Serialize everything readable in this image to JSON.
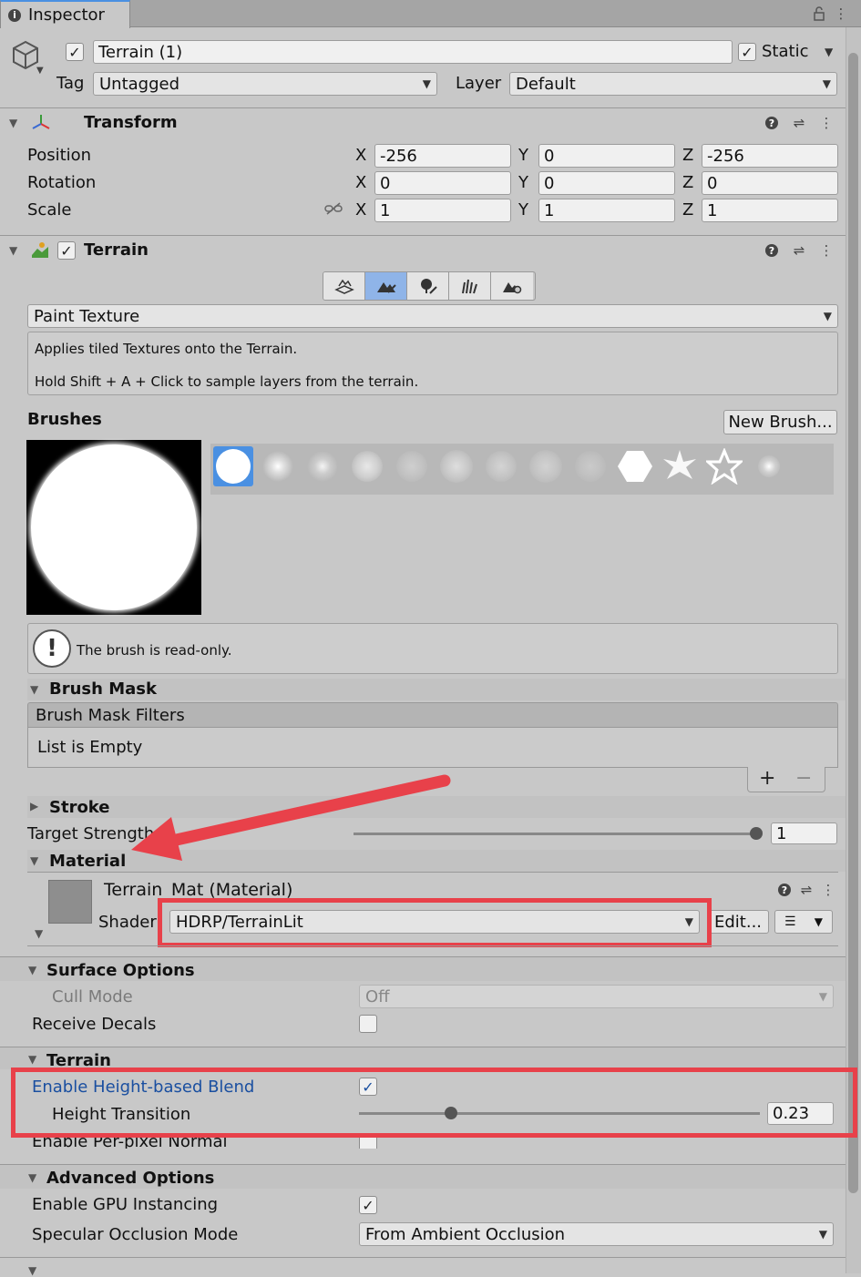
{
  "window": {
    "tab_title": "Inspector"
  },
  "header": {
    "object_name": "Terrain (1)",
    "static_label": "Static",
    "tag_label": "Tag",
    "tag_value": "Untagged",
    "layer_label": "Layer",
    "layer_value": "Default"
  },
  "transform": {
    "title": "Transform",
    "rows": [
      {
        "label": "Position",
        "x": "-256",
        "y": "0",
        "z": "-256"
      },
      {
        "label": "Rotation",
        "x": "0",
        "y": "0",
        "z": "0"
      },
      {
        "label": "Scale",
        "x": "1",
        "y": "1",
        "z": "1"
      }
    ],
    "axis_x": "X",
    "axis_y": "Y",
    "axis_z": "Z"
  },
  "terrain": {
    "title": "Terrain",
    "mode_value": "Paint Texture",
    "help_line1": "Applies tiled Textures onto the Terrain.",
    "help_line2": "Hold Shift + A + Click to sample layers from the terrain.",
    "brushes_label": "Brushes",
    "new_brush_button": "New Brush...",
    "readonly_msg": "The brush is read-only.",
    "brush_mask_title": "Brush Mask",
    "brush_mask_filters": "Brush Mask Filters",
    "list_empty": "List is Empty",
    "plus": "+",
    "minus": "−",
    "stroke_title": "Stroke",
    "target_strength_label": "Target Strength",
    "target_strength_value": "1",
    "target_strength_fraction": 1.0,
    "material_title": "Material"
  },
  "material": {
    "name": "Terrain_Mat (Material)",
    "shader_label": "Shader",
    "shader_value": "HDRP/TerrainLit",
    "edit_button": "Edit...",
    "surface_options_title": "Surface Options",
    "cull_mode_label": "Cull Mode",
    "cull_mode_value": "Off",
    "receive_decals_label": "Receive Decals",
    "terrain_sub_title": "Terrain",
    "height_blend_label": "Enable Height-based Blend",
    "height_transition_label": "Height Transition",
    "height_transition_value": "0.23",
    "height_transition_fraction": 0.23,
    "per_pixel_normal_label": "Enable Per-pixel Normal",
    "advanced_title": "Advanced Options",
    "gpu_instancing_label": "Enable GPU Instancing",
    "specular_occlusion_label": "Specular Occlusion Mode",
    "specular_occlusion_value": "From Ambient Occlusion"
  },
  "colors": {
    "annotation_red": "#e8414a",
    "link_blue": "#1a4fa0",
    "selection_blue": "#4a90e2"
  }
}
